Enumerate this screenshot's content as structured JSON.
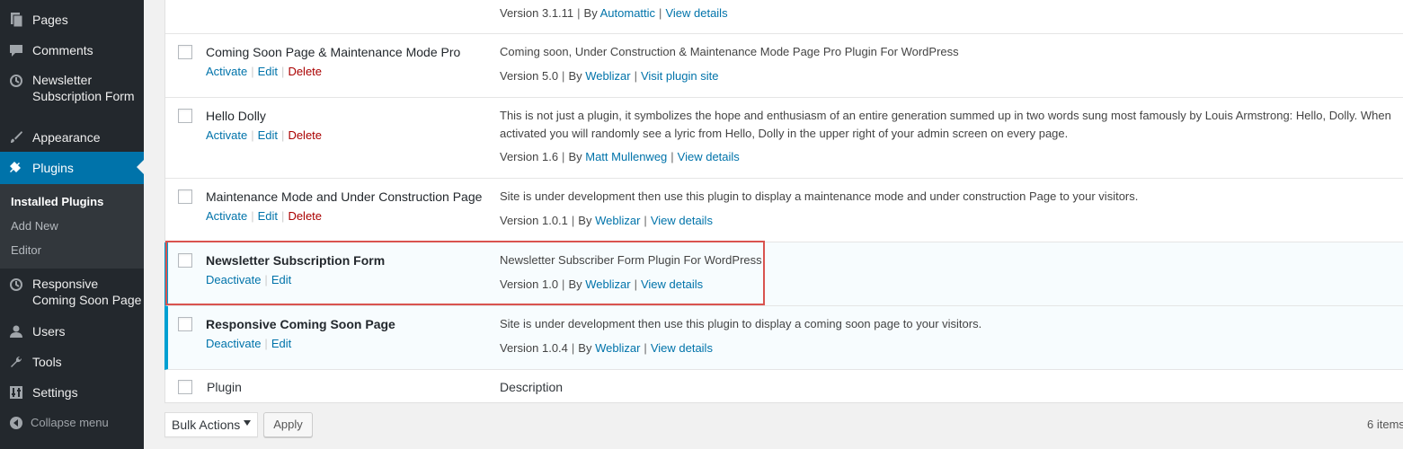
{
  "sidebar": {
    "items": [
      {
        "label": "Pages",
        "icon": "pages-icon"
      },
      {
        "label": "Comments",
        "icon": "comments-icon"
      },
      {
        "label": "Newsletter Subscription Form",
        "icon": "history-icon"
      },
      {
        "label": "Appearance",
        "icon": "paintbrush-icon"
      },
      {
        "label": "Plugins",
        "icon": "plugin-icon"
      },
      {
        "label": "Responsive Coming Soon Page",
        "icon": "history-icon"
      },
      {
        "label": "Users",
        "icon": "users-icon"
      },
      {
        "label": "Tools",
        "icon": "wrench-icon"
      },
      {
        "label": "Settings",
        "icon": "settings-icon"
      }
    ],
    "submenu": [
      "Installed Plugins",
      "Add New",
      "Editor"
    ],
    "collapse_label": "Collapse menu"
  },
  "table": {
    "top_version": {
      "version": "Version 3.1.11",
      "by": "By",
      "author": "Automattic",
      "link": "View details"
    },
    "plugins": [
      {
        "name": "Coming Soon Page & Maintenance Mode Pro",
        "actions": [
          "Activate",
          "Edit",
          "Delete"
        ],
        "description": "Coming soon, Under Construction & Maintenance Mode Page Pro Plugin For WordPress",
        "version": "Version 5.0",
        "by": "By",
        "author": "Weblizar",
        "link": "Visit plugin site",
        "active": false
      },
      {
        "name": "Hello Dolly",
        "actions": [
          "Activate",
          "Edit",
          "Delete"
        ],
        "description": "This is not just a plugin, it symbolizes the hope and enthusiasm of an entire generation summed up in two words sung most famously by Louis Armstrong: Hello, Dolly. When activated you will randomly see a lyric from Hello, Dolly in the upper right of your admin screen on every page.",
        "version": "Version 1.6",
        "by": "By",
        "author": "Matt Mullenweg",
        "link": "View details",
        "active": false
      },
      {
        "name": "Maintenance Mode and Under Construction Page",
        "actions": [
          "Activate",
          "Edit",
          "Delete"
        ],
        "description": "Site is under development then use this plugin to display a maintenance mode and under construction Page to your visitors.",
        "version": "Version 1.0.1",
        "by": "By",
        "author": "Weblizar",
        "link": "View details",
        "active": false
      },
      {
        "name": "Newsletter Subscription Form",
        "actions": [
          "Deactivate",
          "Edit"
        ],
        "description": "Newsletter Subscriber Form Plugin For WordPress",
        "version": "Version 1.0",
        "by": "By",
        "author": "Weblizar",
        "link": "View details",
        "active": true
      },
      {
        "name": "Responsive Coming Soon Page",
        "actions": [
          "Deactivate",
          "Edit"
        ],
        "description": "Site is under development then use this plugin to display a coming soon page to your visitors.",
        "version": "Version 1.0.4",
        "by": "By",
        "author": "Weblizar",
        "link": "View details",
        "active": true
      }
    ],
    "footer": {
      "col_plugin": "Plugin",
      "col_description": "Description"
    }
  },
  "bottom": {
    "bulk_actions": "Bulk Actions",
    "apply": "Apply",
    "count": "6 items"
  },
  "colors": {
    "accent": "#0073aa",
    "sidebar_bg": "#23282d",
    "highlight": "#d9534f",
    "active_border": "#00a0d2"
  }
}
